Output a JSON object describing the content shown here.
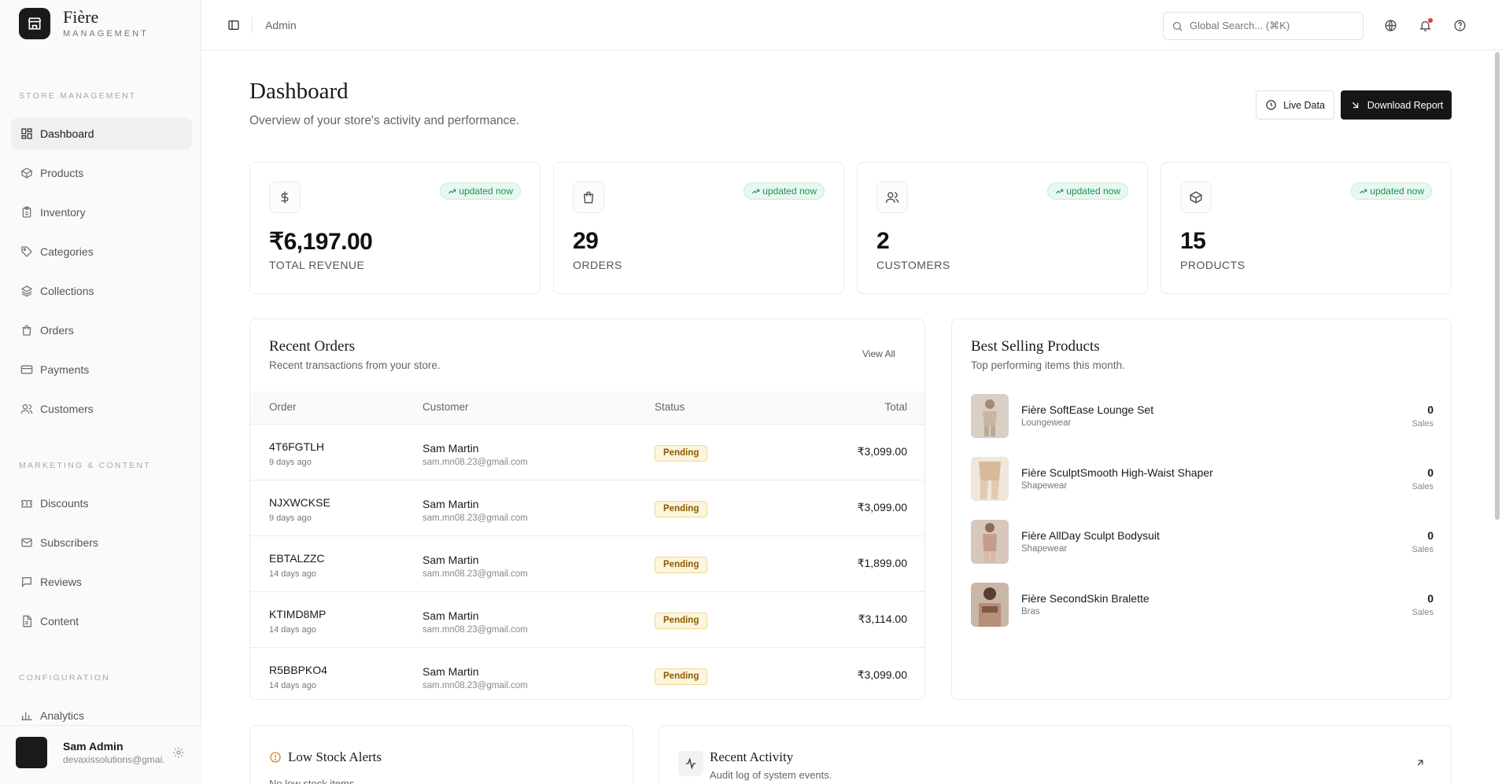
{
  "brand": {
    "name": "Fière",
    "subtitle": "MANAGEMENT"
  },
  "sidebar": {
    "sections": {
      "store": "STORE MANAGEMENT",
      "marketing": "MARKETING & CONTENT",
      "config": "CONFIGURATION"
    },
    "items": [
      {
        "label": "Dashboard",
        "icon": "dashboard-grid-icon"
      },
      {
        "label": "Products",
        "icon": "box-icon"
      },
      {
        "label": "Inventory",
        "icon": "clipboard-icon"
      },
      {
        "label": "Categories",
        "icon": "tag-icon"
      },
      {
        "label": "Collections",
        "icon": "layers-icon"
      },
      {
        "label": "Orders",
        "icon": "shopping-bag-icon"
      },
      {
        "label": "Payments",
        "icon": "credit-card-icon"
      },
      {
        "label": "Customers",
        "icon": "users-icon"
      },
      {
        "label": "Discounts",
        "icon": "ticket-icon"
      },
      {
        "label": "Subscribers",
        "icon": "mail-icon"
      },
      {
        "label": "Reviews",
        "icon": "message-square-icon"
      },
      {
        "label": "Content",
        "icon": "file-icon"
      },
      {
        "label": "Analytics",
        "icon": "bar-chart-icon"
      }
    ],
    "user": {
      "name": "Sam Admin",
      "email": "devaxissolutions@gmai..."
    }
  },
  "topbar": {
    "breadcrumb": "Admin",
    "search_placeholder": "Global Search... (⌘K)"
  },
  "header": {
    "title": "Dashboard",
    "subtitle": "Overview of your store's activity and performance.",
    "live_label": "Live Data",
    "download_label": "Download Report"
  },
  "stats": [
    {
      "value": "₹6,197.00",
      "label": "TOTAL REVENUE",
      "badge": "updated now",
      "icon": "dollar-icon"
    },
    {
      "value": "29",
      "label": "ORDERS",
      "badge": "updated now",
      "icon": "shopping-bag-icon"
    },
    {
      "value": "2",
      "label": "CUSTOMERS",
      "badge": "updated now",
      "icon": "users-icon"
    },
    {
      "value": "15",
      "label": "PRODUCTS",
      "badge": "updated now",
      "icon": "box-icon"
    }
  ],
  "orders": {
    "title": "Recent Orders",
    "subtitle": "Recent transactions from your store.",
    "view_all": "View All",
    "columns": {
      "order": "Order",
      "customer": "Customer",
      "status": "Status",
      "total": "Total"
    },
    "rows": [
      {
        "id": "4T6FGTLH",
        "time": "9 days ago",
        "customer": "Sam Martin",
        "email": "sam.mn08.23@gmail.com",
        "status": "Pending",
        "total": "₹3,099.00"
      },
      {
        "id": "NJXWCKSE",
        "time": "9 days ago",
        "customer": "Sam Martin",
        "email": "sam.mn08.23@gmail.com",
        "status": "Pending",
        "total": "₹3,099.00"
      },
      {
        "id": "EBTALZZC",
        "time": "14 days ago",
        "customer": "Sam Martin",
        "email": "sam.mn08.23@gmail.com",
        "status": "Pending",
        "total": "₹1,899.00"
      },
      {
        "id": "KTIMD8MP",
        "time": "14 days ago",
        "customer": "Sam Martin",
        "email": "sam.mn08.23@gmail.com",
        "status": "Pending",
        "total": "₹3,114.00"
      },
      {
        "id": "R5BBPKO4",
        "time": "14 days ago",
        "customer": "Sam Martin",
        "email": "sam.mn08.23@gmail.com",
        "status": "Pending",
        "total": "₹3,099.00"
      }
    ]
  },
  "best_sellers": {
    "title": "Best Selling Products",
    "subtitle": "Top performing items this month.",
    "items": [
      {
        "name": "Fière SoftEase Lounge Set",
        "category": "Loungewear",
        "sales": "0",
        "sales_label": "Sales"
      },
      {
        "name": "Fière SculptSmooth High-Waist Shaper",
        "category": "Shapewear",
        "sales": "0",
        "sales_label": "Sales"
      },
      {
        "name": "Fière AllDay Sculpt Bodysuit",
        "category": "Shapewear",
        "sales": "0",
        "sales_label": "Sales"
      },
      {
        "name": "Fière SecondSkin Bralette",
        "category": "Bras",
        "sales": "0",
        "sales_label": "Sales"
      }
    ]
  },
  "low_stock": {
    "title": "Low Stock Alerts",
    "subtitle": "No low stock items."
  },
  "activity": {
    "title": "Recent Activity",
    "subtitle": "Audit log of system events."
  },
  "colors": {
    "accent_dark": "#161616",
    "success": "#199457",
    "pending_bg": "#fdf5dd",
    "pending_text": "#8a5a00",
    "alert": "#d9822b"
  }
}
